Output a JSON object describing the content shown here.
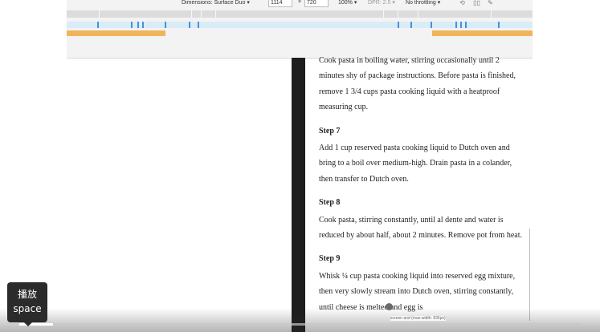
{
  "devtools": {
    "dimensions_label": "Dimensions: Surface Duo",
    "width_value": "1114",
    "x_sep": "×",
    "height_value": "720",
    "zoom": "100%",
    "dpr": "DPR: 2.5",
    "throttling": "No throttling",
    "icons": [
      "rotate-icon",
      "dual-screen-icon",
      "device-posture-icon"
    ]
  },
  "article": {
    "intro": "Cook pasta in boiling water, stirring occasionally until 2 minutes shy of package instructions. Before pasta is finished, remove 1 3/4 cups pasta cooking liquid with a heatproof measuring cup.",
    "steps": [
      {
        "title": "Step 7",
        "text": "Add 1 cup reserved pasta cooking liquid to Dutch oven and bring to a boil over medium-high. Drain pasta in a colander, then transfer to Dutch oven."
      },
      {
        "title": "Step 8",
        "text": "Cook pasta, stirring constantly, until al dente and water is reduced by about half, about 2 minutes. Remove pot from heat."
      },
      {
        "title": "Step 9",
        "text": "Whisk ¼ cup pasta cooking liquid into reserved egg mixture, then very slowly stream into Dutch oven, stirring constantly, until cheese is melted and egg is"
      }
    ]
  },
  "player": {
    "tooltip_line1": "播放",
    "tooltip_line2": "space",
    "preview_label": "screen and (max-width: 835px)",
    "progress_fraction": 0.06
  }
}
